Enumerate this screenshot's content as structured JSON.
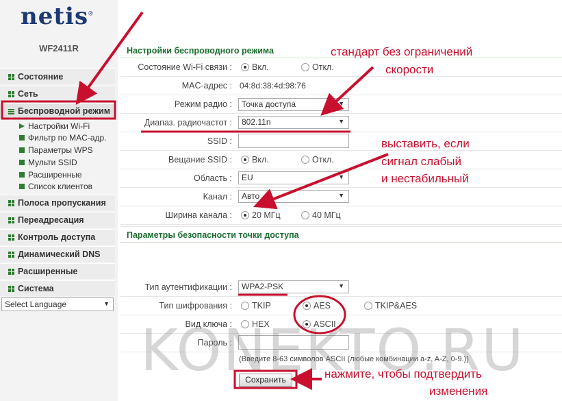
{
  "brand": {
    "logo": "netis",
    "trademark": "®",
    "model": "WF2411R"
  },
  "sidebar": {
    "items": [
      {
        "label": "Состояние"
      },
      {
        "label": "Сеть"
      },
      {
        "label": "Беспроводной режим"
      },
      {
        "label": "Полоса пропускания"
      },
      {
        "label": "Переадресация"
      },
      {
        "label": "Контроль доступа"
      },
      {
        "label": "Динамический DNS"
      },
      {
        "label": "Расширенные"
      },
      {
        "label": "Система"
      }
    ],
    "subitems": [
      {
        "label": "Настройки Wi-Fi"
      },
      {
        "label": "Фильтр по MAC-адр."
      },
      {
        "label": "Параметры WPS"
      },
      {
        "label": "Мульти SSID"
      },
      {
        "label": "Расширенные"
      },
      {
        "label": "Список клиентов"
      }
    ],
    "language": {
      "value": "Select Language"
    }
  },
  "wireless": {
    "title": "Настройки беспроводного режима",
    "wifi_state": {
      "label": "Состояние Wi-Fi связи :",
      "on": "Вкл.",
      "off": "Откл.",
      "selected": "on"
    },
    "mac": {
      "label": "MAC-адрес :",
      "value": "04:8d:38:4d:98:76"
    },
    "radio_mode": {
      "label": "Режим радио :",
      "value": "Точка доступа"
    },
    "band": {
      "label": "Диапаз. радиочастот :",
      "value": "802.11n"
    },
    "ssid": {
      "label": "SSID :",
      "value": ""
    },
    "ssid_broadcast": {
      "label": "Вещание SSID :",
      "on": "Вкл.",
      "off": "Откл.",
      "selected": "on"
    },
    "region": {
      "label": "Область :",
      "value": "EU"
    },
    "channel": {
      "label": "Канал :",
      "value": "Авто"
    },
    "width": {
      "label": "Ширина канала :",
      "opt1": "20 МГц",
      "opt2": "40 МГц",
      "selected": "opt1"
    }
  },
  "security": {
    "title": "Параметры безопасности точки доступа",
    "auth": {
      "label": "Тип аутентификации :",
      "value": "WPA2-PSK"
    },
    "cipher": {
      "label": "Тип шифрования :",
      "opt1": "TKIP",
      "opt2": "AES",
      "opt3": "TKIP&AES",
      "selected": "opt2"
    },
    "key_type": {
      "label": "Вид ключа :",
      "opt1": "HEX",
      "opt2": "ASCII",
      "selected": "opt2"
    },
    "password": {
      "label": "Пароль :",
      "value": ""
    },
    "hint": "(Введите 8-63 символов ASCII (любые комбинации a-z, A-Z, 0-9.))",
    "save_label": "Сохранить"
  },
  "annotations": {
    "a1_line1": "стандарт без ограничений",
    "a1_line2": "скорости",
    "a2_line1": "выставить, если",
    "a2_line2": "сигнал слабый",
    "a2_line3": "и нестабильный",
    "a3_line1": "нажмите, чтобы подтвердить",
    "a3_line2": "изменения",
    "color": "#c8102e"
  },
  "watermark": "KONEKTO.RU",
  "colors": {
    "accent": "#1a6d2e",
    "brand": "#1d3a73",
    "annotation": "#c8102e"
  }
}
